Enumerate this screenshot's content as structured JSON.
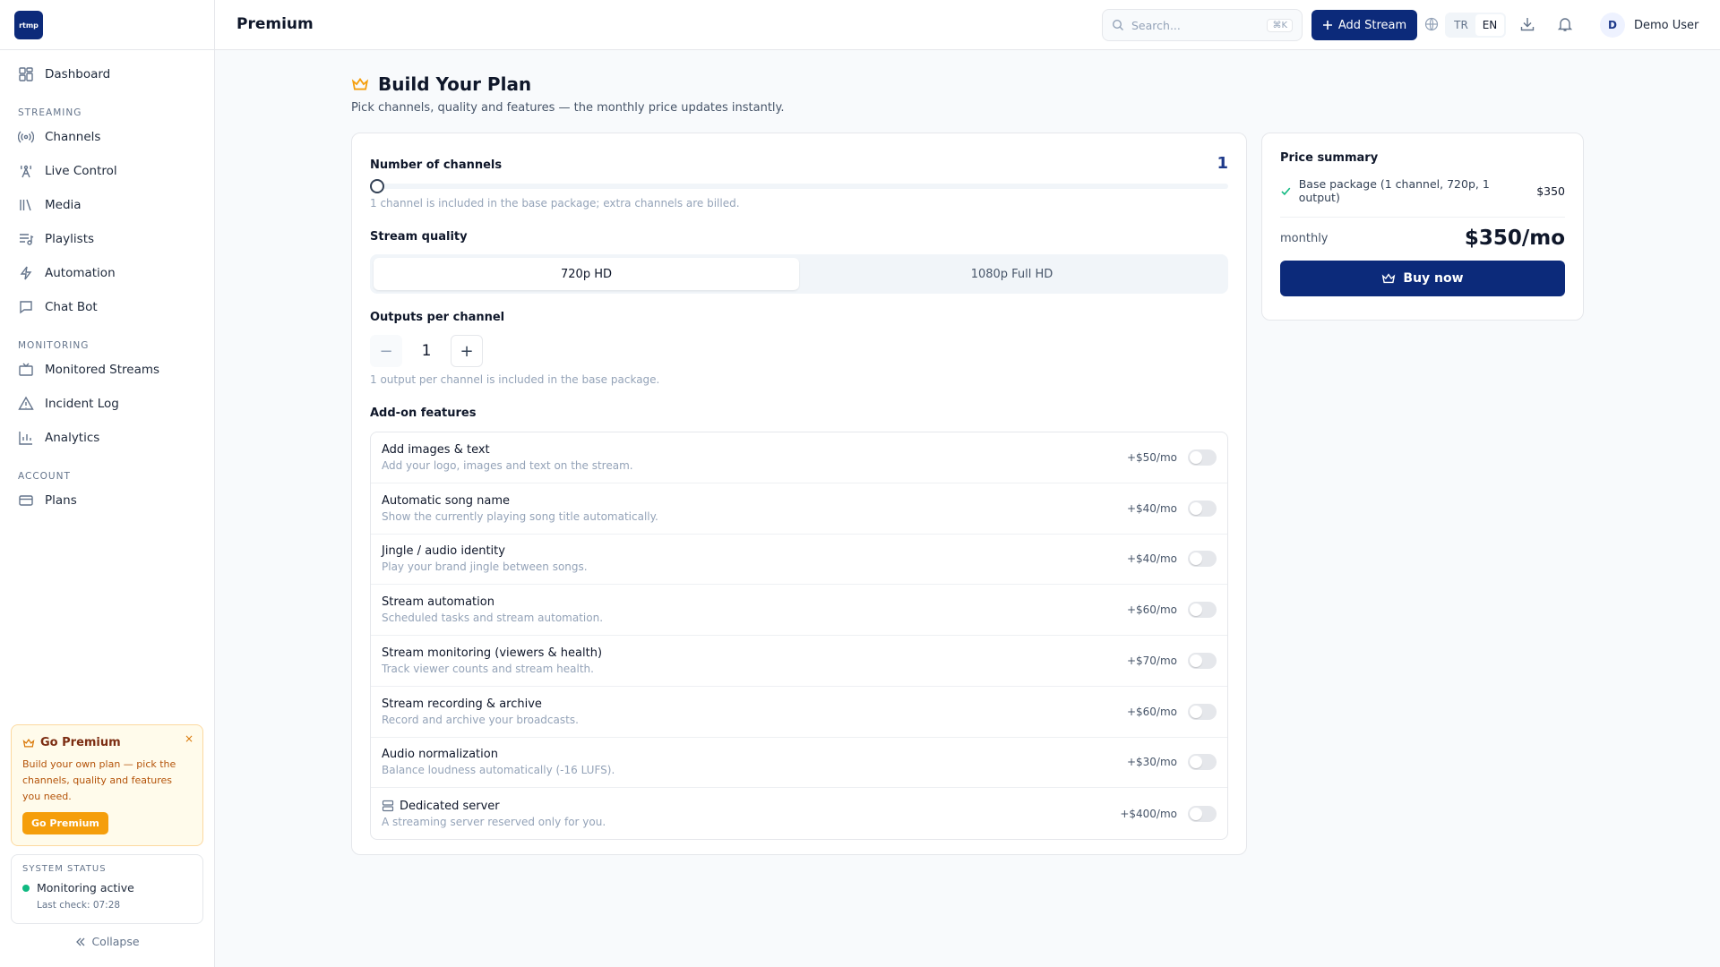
{
  "app": {
    "logo_text": "rtmp"
  },
  "sidebar": {
    "items": [
      {
        "label": "Dashboard",
        "icon": "dashboard-grid-icon"
      },
      {
        "label": "Channels",
        "icon": "broadcast-icon"
      },
      {
        "label": "Live Control",
        "icon": "tower-icon"
      },
      {
        "label": "Media",
        "icon": "media-library-icon"
      },
      {
        "label": "Playlists",
        "icon": "playlist-icon"
      },
      {
        "label": "Automation",
        "icon": "bolt-icon"
      },
      {
        "label": "Chat Bot",
        "icon": "chat-icon"
      },
      {
        "label": "Monitored Streams",
        "icon": "tv-icon"
      },
      {
        "label": "Incident Log",
        "icon": "warning-icon"
      },
      {
        "label": "Analytics",
        "icon": "bar-chart-icon"
      },
      {
        "label": "Plans",
        "icon": "credit-card-icon"
      }
    ],
    "sections": [
      "STREAMING",
      "MONITORING",
      "ACCOUNT"
    ],
    "premium_card": {
      "title": "Go Premium",
      "description": "Build your own plan — pick the channels, quality and features you need.",
      "button": "Go Premium",
      "close": "×"
    },
    "system_status": {
      "label": "SYSTEM STATUS",
      "status": "Monitoring active",
      "last_check": "Last check: 07:28"
    },
    "collapse": "Collapse"
  },
  "header": {
    "title": "Premium",
    "search_placeholder": "Search...",
    "search_shortcut": "⌘K",
    "add_stream": "Add Stream",
    "languages": [
      "TR",
      "EN"
    ],
    "active_language": "EN",
    "user_initial": "D",
    "user_name": "Demo User"
  },
  "builder": {
    "title": "Build Your Plan",
    "subtitle": "Pick channels, quality and features — the monthly price updates instantly.",
    "channels": {
      "label": "Number of channels",
      "value": "1",
      "slider_fraction": 0,
      "hint": "1 channel is included in the base package; extra channels are billed."
    },
    "quality": {
      "label": "Stream quality",
      "options": [
        "720p HD",
        "1080p Full HD"
      ],
      "selected": "720p HD"
    },
    "outputs": {
      "label": "Outputs per channel",
      "value": "1",
      "minus": "−",
      "plus": "+",
      "hint": "1 output per channel is included in the base package."
    },
    "addons_label": "Add-on features",
    "addons": [
      {
        "name": "Add images & text",
        "desc": "Add your logo, images and text on the stream.",
        "price": "+$50/mo",
        "enabled": false
      },
      {
        "name": "Automatic song name",
        "desc": "Show the currently playing song title automatically.",
        "price": "+$40/mo",
        "enabled": false
      },
      {
        "name": "Jingle / audio identity",
        "desc": "Play your brand jingle between songs.",
        "price": "+$40/mo",
        "enabled": false
      },
      {
        "name": "Stream automation",
        "desc": "Scheduled tasks and stream automation.",
        "price": "+$60/mo",
        "enabled": false
      },
      {
        "name": "Stream monitoring (viewers & health)",
        "desc": "Track viewer counts and stream health.",
        "price": "+$70/mo",
        "enabled": false
      },
      {
        "name": "Stream recording & archive",
        "desc": "Record and archive your broadcasts.",
        "price": "+$60/mo",
        "enabled": false
      },
      {
        "name": "Audio normalization",
        "desc": "Balance loudness automatically (-16 LUFS).",
        "price": "+$30/mo",
        "enabled": false
      },
      {
        "name": "Dedicated server",
        "desc": "A streaming server reserved only for you.",
        "price": "+$400/mo",
        "enabled": false,
        "icon": "server-icon"
      }
    ]
  },
  "summary": {
    "title": "Price summary",
    "line_label": "Base package (1 channel, 720p, 1 output)",
    "line_amount": "$350",
    "period": "monthly",
    "total": "$350/mo",
    "buy": "Buy now"
  },
  "colors": {
    "brand": "#0c2a7a",
    "accent_premium": "#f59e0b",
    "status_ok": "#10b981"
  }
}
